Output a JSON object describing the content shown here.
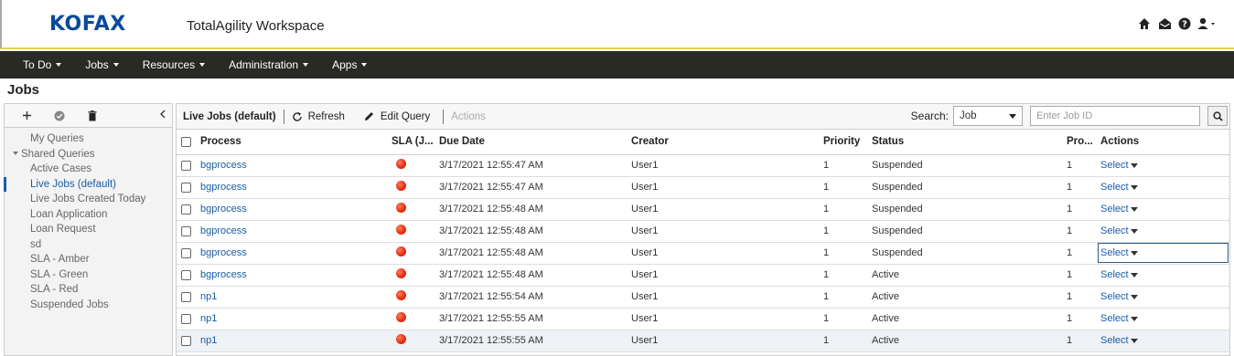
{
  "header": {
    "logo": "KOFAX",
    "app_title": "TotalAgility Workspace",
    "icons": [
      "home-icon",
      "inbox-icon",
      "help-icon",
      "user-icon"
    ]
  },
  "nav": {
    "items": [
      {
        "label": "To Do"
      },
      {
        "label": "Jobs"
      },
      {
        "label": "Resources"
      },
      {
        "label": "Administration"
      },
      {
        "label": "Apps"
      }
    ]
  },
  "page": {
    "title": "Jobs"
  },
  "sidebar": {
    "toolbar_icons": [
      "add-icon",
      "check-icon",
      "delete-icon",
      "collapse-icon"
    ],
    "items": [
      {
        "label": "My Queries",
        "group": false
      },
      {
        "label": "Shared Queries",
        "group": true
      },
      {
        "label": "Active Cases",
        "group": false
      },
      {
        "label": "Live Jobs (default)",
        "group": false,
        "active": true
      },
      {
        "label": "Live Jobs Created Today",
        "group": false
      },
      {
        "label": "Loan Application",
        "group": false
      },
      {
        "label": "Loan Request",
        "group": false
      },
      {
        "label": "sd",
        "group": false
      },
      {
        "label": "SLA - Amber",
        "group": false
      },
      {
        "label": "SLA - Green",
        "group": false
      },
      {
        "label": "SLA - Red",
        "group": false
      },
      {
        "label": "Suspended Jobs",
        "group": false
      }
    ]
  },
  "toolbar": {
    "query_name": "Live Jobs (default)",
    "refresh_label": "Refresh",
    "edit_query_label": "Edit Query",
    "actions_label": "Actions",
    "search_label": "Search:",
    "search_type": "Job",
    "search_placeholder": "Enter Job ID"
  },
  "table": {
    "columns": [
      "Process",
      "SLA (J...",
      "Due Date",
      "Creator",
      "Priority",
      "Status",
      "Pro...",
      "Actions"
    ],
    "rows": [
      {
        "process": "bgprocess",
        "due": "3/17/2021 12:55:47 AM",
        "creator": "User1",
        "priority": "1",
        "status": "Suspended",
        "pro": "1",
        "action": "Select"
      },
      {
        "process": "bgprocess",
        "due": "3/17/2021 12:55:47 AM",
        "creator": "User1",
        "priority": "1",
        "status": "Suspended",
        "pro": "1",
        "action": "Select"
      },
      {
        "process": "bgprocess",
        "due": "3/17/2021 12:55:48 AM",
        "creator": "User1",
        "priority": "1",
        "status": "Suspended",
        "pro": "1",
        "action": "Select"
      },
      {
        "process": "bgprocess",
        "due": "3/17/2021 12:55:48 AM",
        "creator": "User1",
        "priority": "1",
        "status": "Suspended",
        "pro": "1",
        "action": "Select"
      },
      {
        "process": "bgprocess",
        "due": "3/17/2021 12:55:48 AM",
        "creator": "User1",
        "priority": "1",
        "status": "Suspended",
        "pro": "1",
        "action": "Select"
      },
      {
        "process": "bgprocess",
        "due": "3/17/2021 12:55:48 AM",
        "creator": "User1",
        "priority": "1",
        "status": "Active",
        "pro": "1",
        "action": "Select"
      },
      {
        "process": "np1",
        "due": "3/17/2021 12:55:54 AM",
        "creator": "User1",
        "priority": "1",
        "status": "Active",
        "pro": "1",
        "action": "Select"
      },
      {
        "process": "np1",
        "due": "3/17/2021 12:55:55 AM",
        "creator": "User1",
        "priority": "1",
        "status": "Active",
        "pro": "1",
        "action": "Select"
      },
      {
        "process": "np1",
        "due": "3/17/2021 12:55:55 AM",
        "creator": "User1",
        "priority": "1",
        "status": "Active",
        "pro": "1",
        "action": "Select"
      }
    ]
  },
  "colors": {
    "brand": "#0a4a9a",
    "nav_bg": "#2a2a24",
    "link": "#1a5da8",
    "sla_red": "#e22b0f",
    "header_accent": "#e4d04b"
  }
}
